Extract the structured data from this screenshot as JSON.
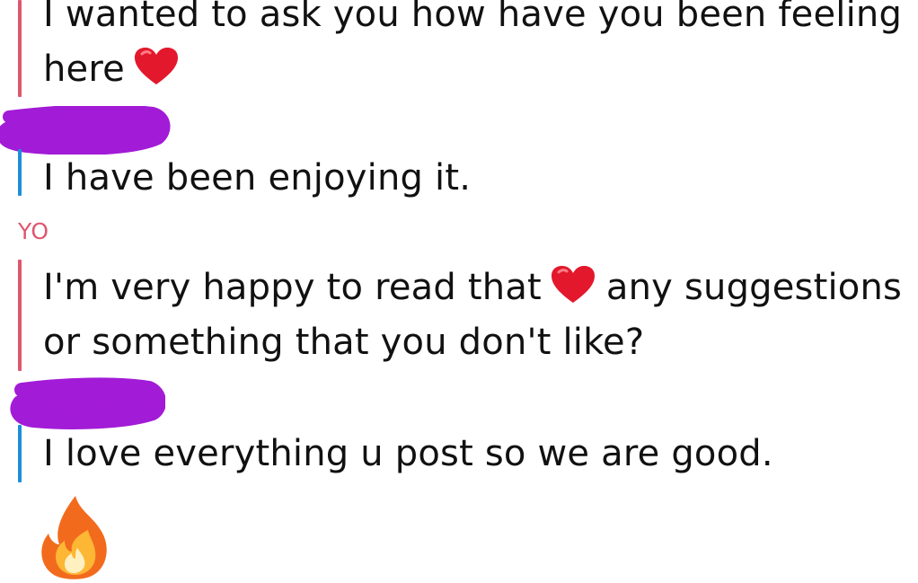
{
  "chat": {
    "messages": [
      {
        "sender": "me",
        "line1": "I wanted to ask you how have you been feeling",
        "line2": "here"
      },
      {
        "sender": "them",
        "line1": "I have been enjoying it."
      },
      {
        "sender": "me",
        "sender_label": "YO",
        "line1_part1": "I'm very happy to read that",
        "line1_part2": "any suggestions",
        "line2": "or something that you don't like?"
      },
      {
        "sender": "them",
        "line1": "I love everything u post so we are good."
      }
    ],
    "reaction_icon": "fire-icon",
    "inline_icon": "heart-icon",
    "colors": {
      "me_accent": "#e0566f",
      "them_accent": "#1d8fd9",
      "redaction": "#a21bd6"
    }
  }
}
